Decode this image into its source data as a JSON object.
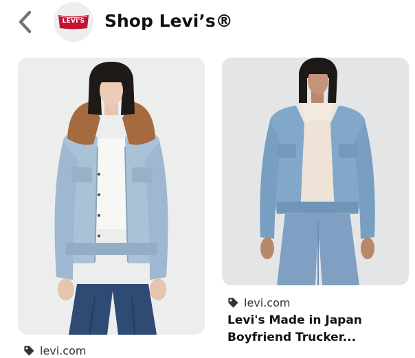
{
  "header": {
    "back_icon": "chevron-left-icon",
    "logo_text": "LEVI'S",
    "title": "Shop Levi’s®",
    "brand_color": "#c41230"
  },
  "pins": [
    {
      "image": "woman-light-denim-sherpa-trucker-jacket-brown-collar",
      "source_icon": "tag-icon",
      "source": "levi.com"
    },
    {
      "image": "woman-light-denim-trucker-jacket-cream-hoodie",
      "source_icon": "tag-icon",
      "source": "levi.com",
      "title": "Levi's Made in Japan Boyfriend Trucker..."
    }
  ]
}
